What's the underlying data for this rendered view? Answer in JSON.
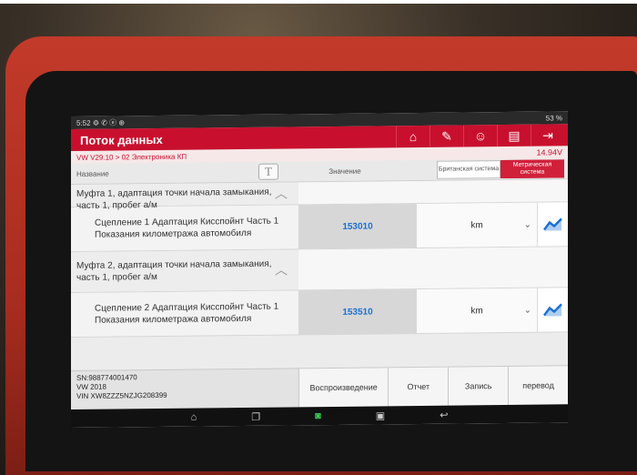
{
  "status": {
    "time": "5:52",
    "icons_left": "⚙ ✆ ⓔ ⊕",
    "battery": "53 %"
  },
  "app": {
    "title": "Поток данных",
    "tools": [
      "home-icon",
      "edit-icon",
      "user-icon",
      "print-icon",
      "exit-icon"
    ]
  },
  "breadcrumb": {
    "path": "VW V29.10 > 02 Электроника КП",
    "voltage": "14.94V"
  },
  "columns": {
    "name": "Название",
    "text_size": "T",
    "value": "Значение",
    "unit_british": "Британская система",
    "unit_metric": "Метрическая система"
  },
  "rows": [
    {
      "type": "group",
      "name": "Муфта 1, адаптация точки начала замыкания, часть 1, пробег а/м"
    },
    {
      "type": "item",
      "name": "Сцепление 1 Адаптация Кисспойнт Часть 1 Показания километража автомобиля",
      "value": "153010",
      "unit": "km"
    },
    {
      "type": "group",
      "name": "Муфта 2, адаптация точки начала замыкания, часть 1, пробег а/м"
    },
    {
      "type": "item",
      "name": "Сцепление 2 Адаптация Кисспойнт Часть 1 Показания километража автомобиля",
      "value": "153510",
      "unit": "km"
    }
  ],
  "vehicle": {
    "sn": "SN:988774001470",
    "model": "VW  2018",
    "vin": "VIN XW8ZZZ5NZJG208399"
  },
  "buttons": {
    "playback": "Воспроизведение",
    "report": "Отчет",
    "record": "Запись",
    "translate": "перевод"
  },
  "colors": {
    "accent": "#c8102e",
    "value": "#1a6fd6",
    "case": "#c23a2a"
  }
}
